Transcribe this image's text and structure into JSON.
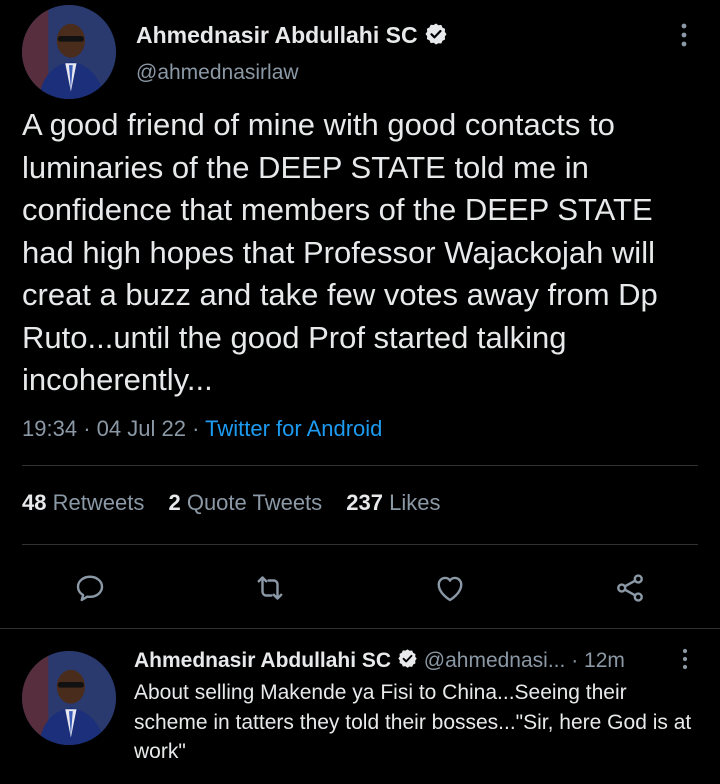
{
  "main_tweet": {
    "author_name": "Ahmednasir Abdullahi SC",
    "author_handle": "@ahmednasirlaw",
    "text": "A good friend of mine with good contacts to luminaries of the DEEP STATE told me in confidence that members of the DEEP STATE had high hopes that Professor Wajackojah will creat a buzz and take few votes away from Dp Ruto...until the good Prof started talking incoherently...",
    "time": "19:34",
    "date": "04 Jul 22",
    "source": "Twitter for Android",
    "separator": "·",
    "stats": {
      "retweets_count": "48",
      "retweets_label": "Retweets",
      "quotes_count": "2",
      "quotes_label": "Quote Tweets",
      "likes_count": "237",
      "likes_label": "Likes"
    }
  },
  "reply": {
    "author_name": "Ahmednasir Abdullahi SC",
    "author_handle": "@ahmednasi...",
    "time_ago": "12m",
    "separator": "·",
    "text": "About selling Makende ya Fisi to China...Seeing their scheme in tatters they told their bosses...\"Sir, here God is at work\""
  },
  "icons": {
    "verified": "verified-badge-icon",
    "more": "more-vertical-icon",
    "reply": "reply-icon",
    "retweet": "retweet-icon",
    "like": "heart-icon",
    "share": "share-icon"
  },
  "colors": {
    "background": "#000000",
    "text": "#e7e9ea",
    "secondary": "#8b98a5",
    "link": "#1d9bf0",
    "divider": "#2f3336"
  }
}
